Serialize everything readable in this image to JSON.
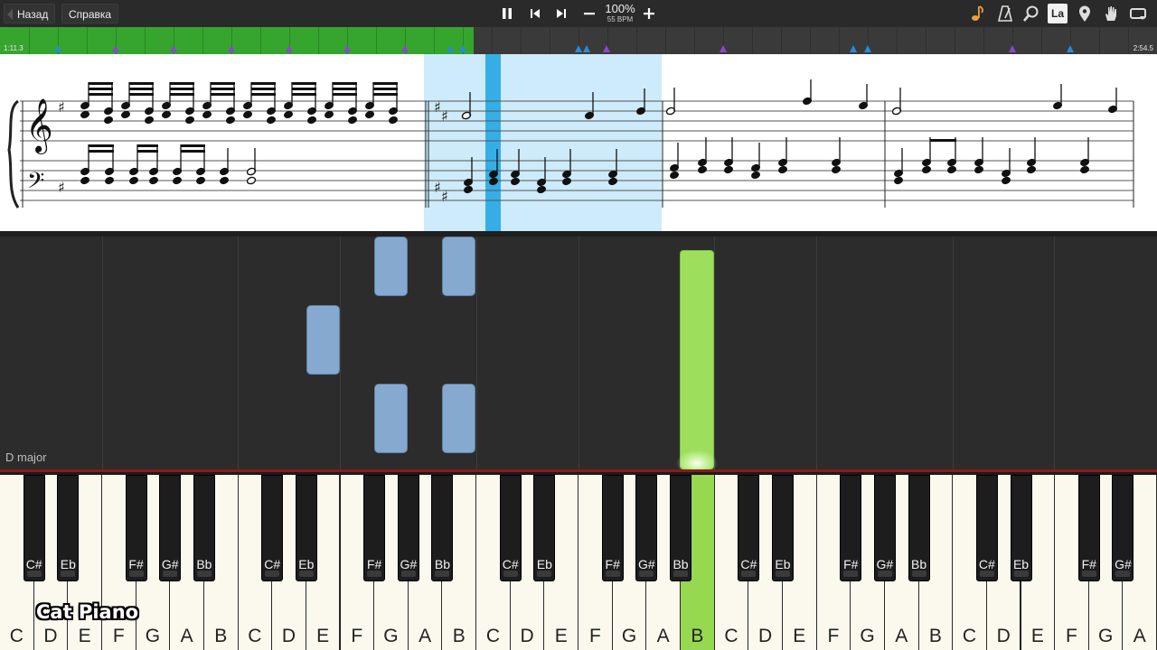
{
  "toolbar": {
    "back_label": "Назад",
    "help_label": "Справка",
    "pause_icon": "pause-icon",
    "prev_icon": "skip-back-icon",
    "next_icon": "skip-forward-icon",
    "minus_icon": "minus-icon",
    "plus_icon": "plus-icon",
    "speed_percent": "100%",
    "tempo": "55 BPM",
    "right_icons": [
      "note-icon",
      "metronome-icon",
      "magnifier-icon",
      "la-icon",
      "marker-icon",
      "hand-icon",
      "loop-icon"
    ],
    "la_label": "La"
  },
  "timeline": {
    "elapsed": "1:11.3",
    "total": "2:54.5",
    "progress_fraction": 0.409,
    "marker_color_blue": "#2a8ad4",
    "marker_color_purple": "#8a49c9",
    "played_color": "#35a52e"
  },
  "falling": {
    "key_signature_label": "D major",
    "note_color": "#86a9cf",
    "active_note_color": "#9ede5d"
  },
  "keyboard": {
    "white_keys": [
      "C",
      "D",
      "E",
      "F",
      "G",
      "A",
      "B",
      "C",
      "D",
      "E",
      "F",
      "G",
      "A",
      "B",
      "C",
      "D",
      "E",
      "F",
      "G",
      "A",
      "B",
      "C",
      "D",
      "E",
      "F",
      "G",
      "A",
      "B",
      "C",
      "D",
      "E",
      "F",
      "G",
      "A",
      "B"
    ],
    "black_keys": [
      "C#",
      "Eb",
      "F#",
      "G#",
      "Bb",
      "C#",
      "Eb",
      "F#",
      "G#",
      "Bb",
      "C#",
      "Eb",
      "F#",
      "G#",
      "Bb",
      "C#",
      "Eb",
      "F#",
      "G#",
      "Bb",
      "C#",
      "Eb",
      "F#",
      "G#"
    ],
    "active_key": "B"
  },
  "brand": "Cat Piano"
}
